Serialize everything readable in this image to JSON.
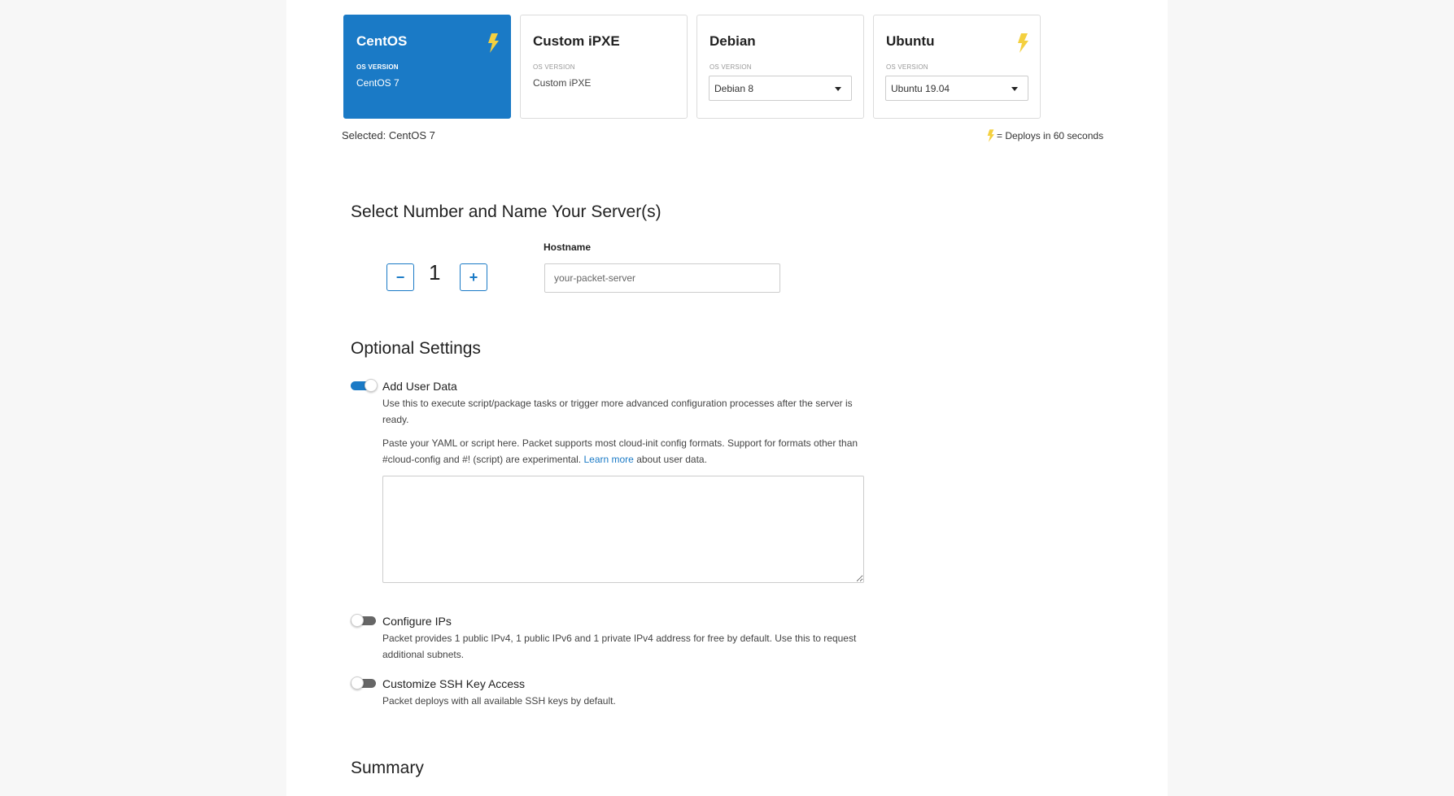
{
  "os_cards": [
    {
      "name": "CentOS",
      "version_label": "OS VERSION",
      "version": "CentOS 7",
      "fast_deploy": true,
      "selected": true
    },
    {
      "name": "Custom iPXE",
      "version_label": "OS VERSION",
      "version": "Custom iPXE",
      "fast_deploy": false,
      "selected": false
    },
    {
      "name": "Debian",
      "version_label": "OS VERSION",
      "version": "Debian 8",
      "fast_deploy": false,
      "selected": false
    },
    {
      "name": "Ubuntu",
      "version_label": "OS VERSION",
      "version": "Ubuntu 19.04",
      "fast_deploy": true,
      "selected": false
    }
  ],
  "selected_text": "Selected: CentOS 7",
  "deploy_note": "= Deploys in 60 seconds",
  "servers": {
    "heading": "Select Number and Name Your Server(s)",
    "decrement": "−",
    "count": "1",
    "increment": "+",
    "hostname_label": "Hostname",
    "hostname_placeholder": "your-packet-server"
  },
  "optional": {
    "heading": "Optional Settings",
    "user_data": {
      "label": "Add User Data",
      "enabled": true,
      "desc": "Use this to execute script/package tasks or trigger more advanced configuration processes after the server is ready.",
      "paste_text": "Paste your YAML or script here. Packet supports most cloud-init config formats. Support for formats other than #cloud-config and #! (script) are experimental.",
      "learn_more": "Learn more",
      "after_link": "about user data."
    },
    "configure_ips": {
      "label": "Configure IPs",
      "enabled": false,
      "desc": "Packet provides 1 public IPv4, 1 public IPv6 and 1 private IPv4 address for free by default. Use this to request additional subnets."
    },
    "ssh_keys": {
      "label": "Customize SSH Key Access",
      "enabled": false,
      "desc": "Packet deploys with all available SSH keys by default."
    }
  },
  "summary": {
    "heading": "Summary"
  },
  "colors": {
    "accent": "#1a7ac6",
    "bolt": "#f4d03f"
  },
  "icons": {
    "fast_deploy": "lightning-bolt-icon",
    "dropdown": "caret-down-icon"
  }
}
